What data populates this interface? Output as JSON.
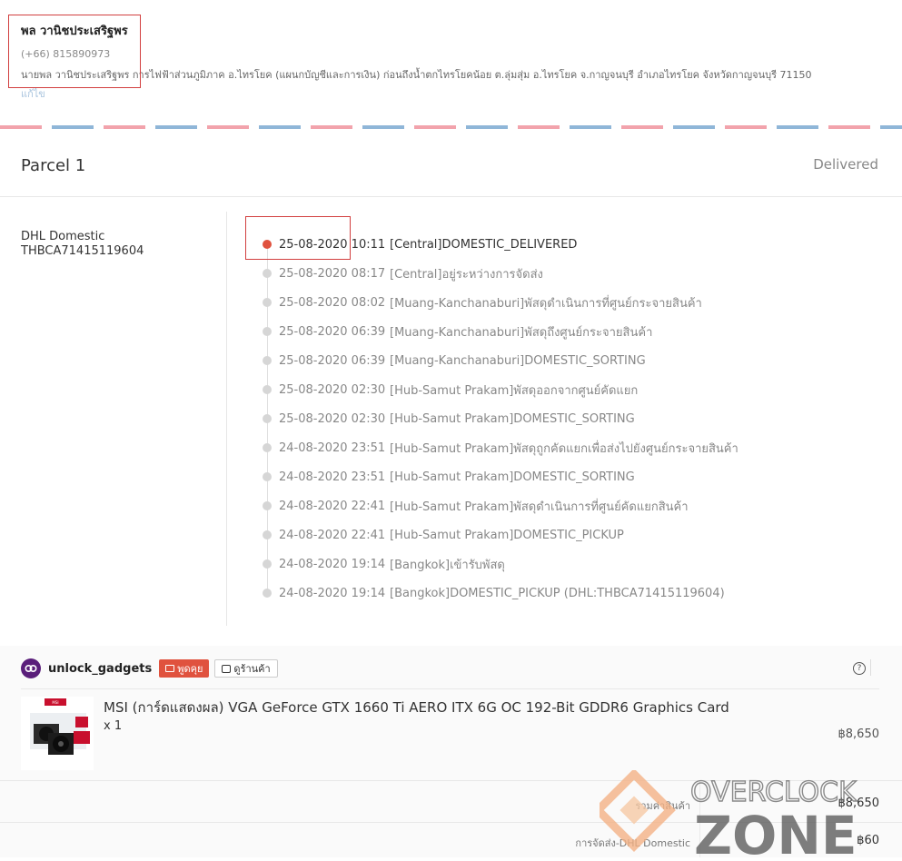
{
  "address": {
    "name": "พล วานิชประเสริฐพร",
    "phone": "(+66) 815890973",
    "line": "นายพล วานิชประเสริฐพร การไฟฟ้าส่วนภูมิภาค อ.ไทรโยค (แผนกบัญชีและการเงิน) ก่อนถึงน้ำตกไทรโยคน้อย ต.ลุ่มสุ่ม อ.ไทรโยค จ.กาญจนบุรี อำเภอไทรโยค จังหวัดกาญจนบุรี 71150",
    "edit_label": "แก้ไข"
  },
  "parcel": {
    "title": "Parcel 1",
    "status": "Delivered",
    "carrier": "DHL Domestic",
    "tracking": "THBCA71415119604",
    "events": [
      {
        "time": "25-08-2020 10:11",
        "desc": "[Central]DOMESTIC_DELIVERED"
      },
      {
        "time": "25-08-2020 08:17",
        "desc": "[Central]อยู่ระหว่างการจัดส่ง"
      },
      {
        "time": "25-08-2020 08:02",
        "desc": "[Muang-Kanchanaburi]พัสดุดำเนินการที่ศูนย์กระจายสินค้า"
      },
      {
        "time": "25-08-2020 06:39",
        "desc": "[Muang-Kanchanaburi]พัสดุถึงศูนย์กระจายสินค้า"
      },
      {
        "time": "25-08-2020 06:39",
        "desc": "[Muang-Kanchanaburi]DOMESTIC_SORTING"
      },
      {
        "time": "25-08-2020 02:30",
        "desc": "[Hub-Samut Prakam]พัสดุออกจากศูนย์คัดแยก"
      },
      {
        "time": "25-08-2020 02:30",
        "desc": "[Hub-Samut Prakam]DOMESTIC_SORTING"
      },
      {
        "time": "24-08-2020 23:51",
        "desc": "[Hub-Samut Prakam]พัสดุถูกคัดแยกเพื่อส่งไปยังศูนย์กระจายสินค้า"
      },
      {
        "time": "24-08-2020 23:51",
        "desc": "[Hub-Samut Prakam]DOMESTIC_SORTING"
      },
      {
        "time": "24-08-2020 22:41",
        "desc": "[Hub-Samut Prakam]พัสดุดำเนินการที่ศูนย์คัดแยกสินค้า"
      },
      {
        "time": "24-08-2020 22:41",
        "desc": "[Hub-Samut Prakam]DOMESTIC_PICKUP"
      },
      {
        "time": "24-08-2020 19:14",
        "desc": "[Bangkok]เข้ารับพัสดุ"
      },
      {
        "time": "24-08-2020 19:14",
        "desc": "[Bangkok]DOMESTIC_PICKUP (DHL:THBCA71415119604)"
      }
    ]
  },
  "shop": {
    "name": "unlock_gadgets",
    "chat_label": "พูดคุย",
    "view_shop_label": "ดูร้านค้า",
    "help_icon": "?"
  },
  "product": {
    "name": "MSI (การ์ดแสดงผล) VGA GeForce GTX 1660 Ti AERO ITX 6G OC 192-Bit GDDR6 Graphics Card",
    "qty": "x 1",
    "price": "฿8,650",
    "image_label": "MSI"
  },
  "summary": {
    "subtotal_label": "รวมค่าสินค้า",
    "subtotal": "฿8,650",
    "shipping_label": "การจัดส่ง-DHL Domestic",
    "shipping": "฿60"
  },
  "watermark": {
    "line1": "OVERCLOCK",
    "line2": "ZONE"
  },
  "colors": {
    "accent": "#e0523e",
    "highlight_box": "#d23f3f",
    "airmail_red": "#f2a3ac",
    "airmail_blue": "#8fb6d8"
  }
}
